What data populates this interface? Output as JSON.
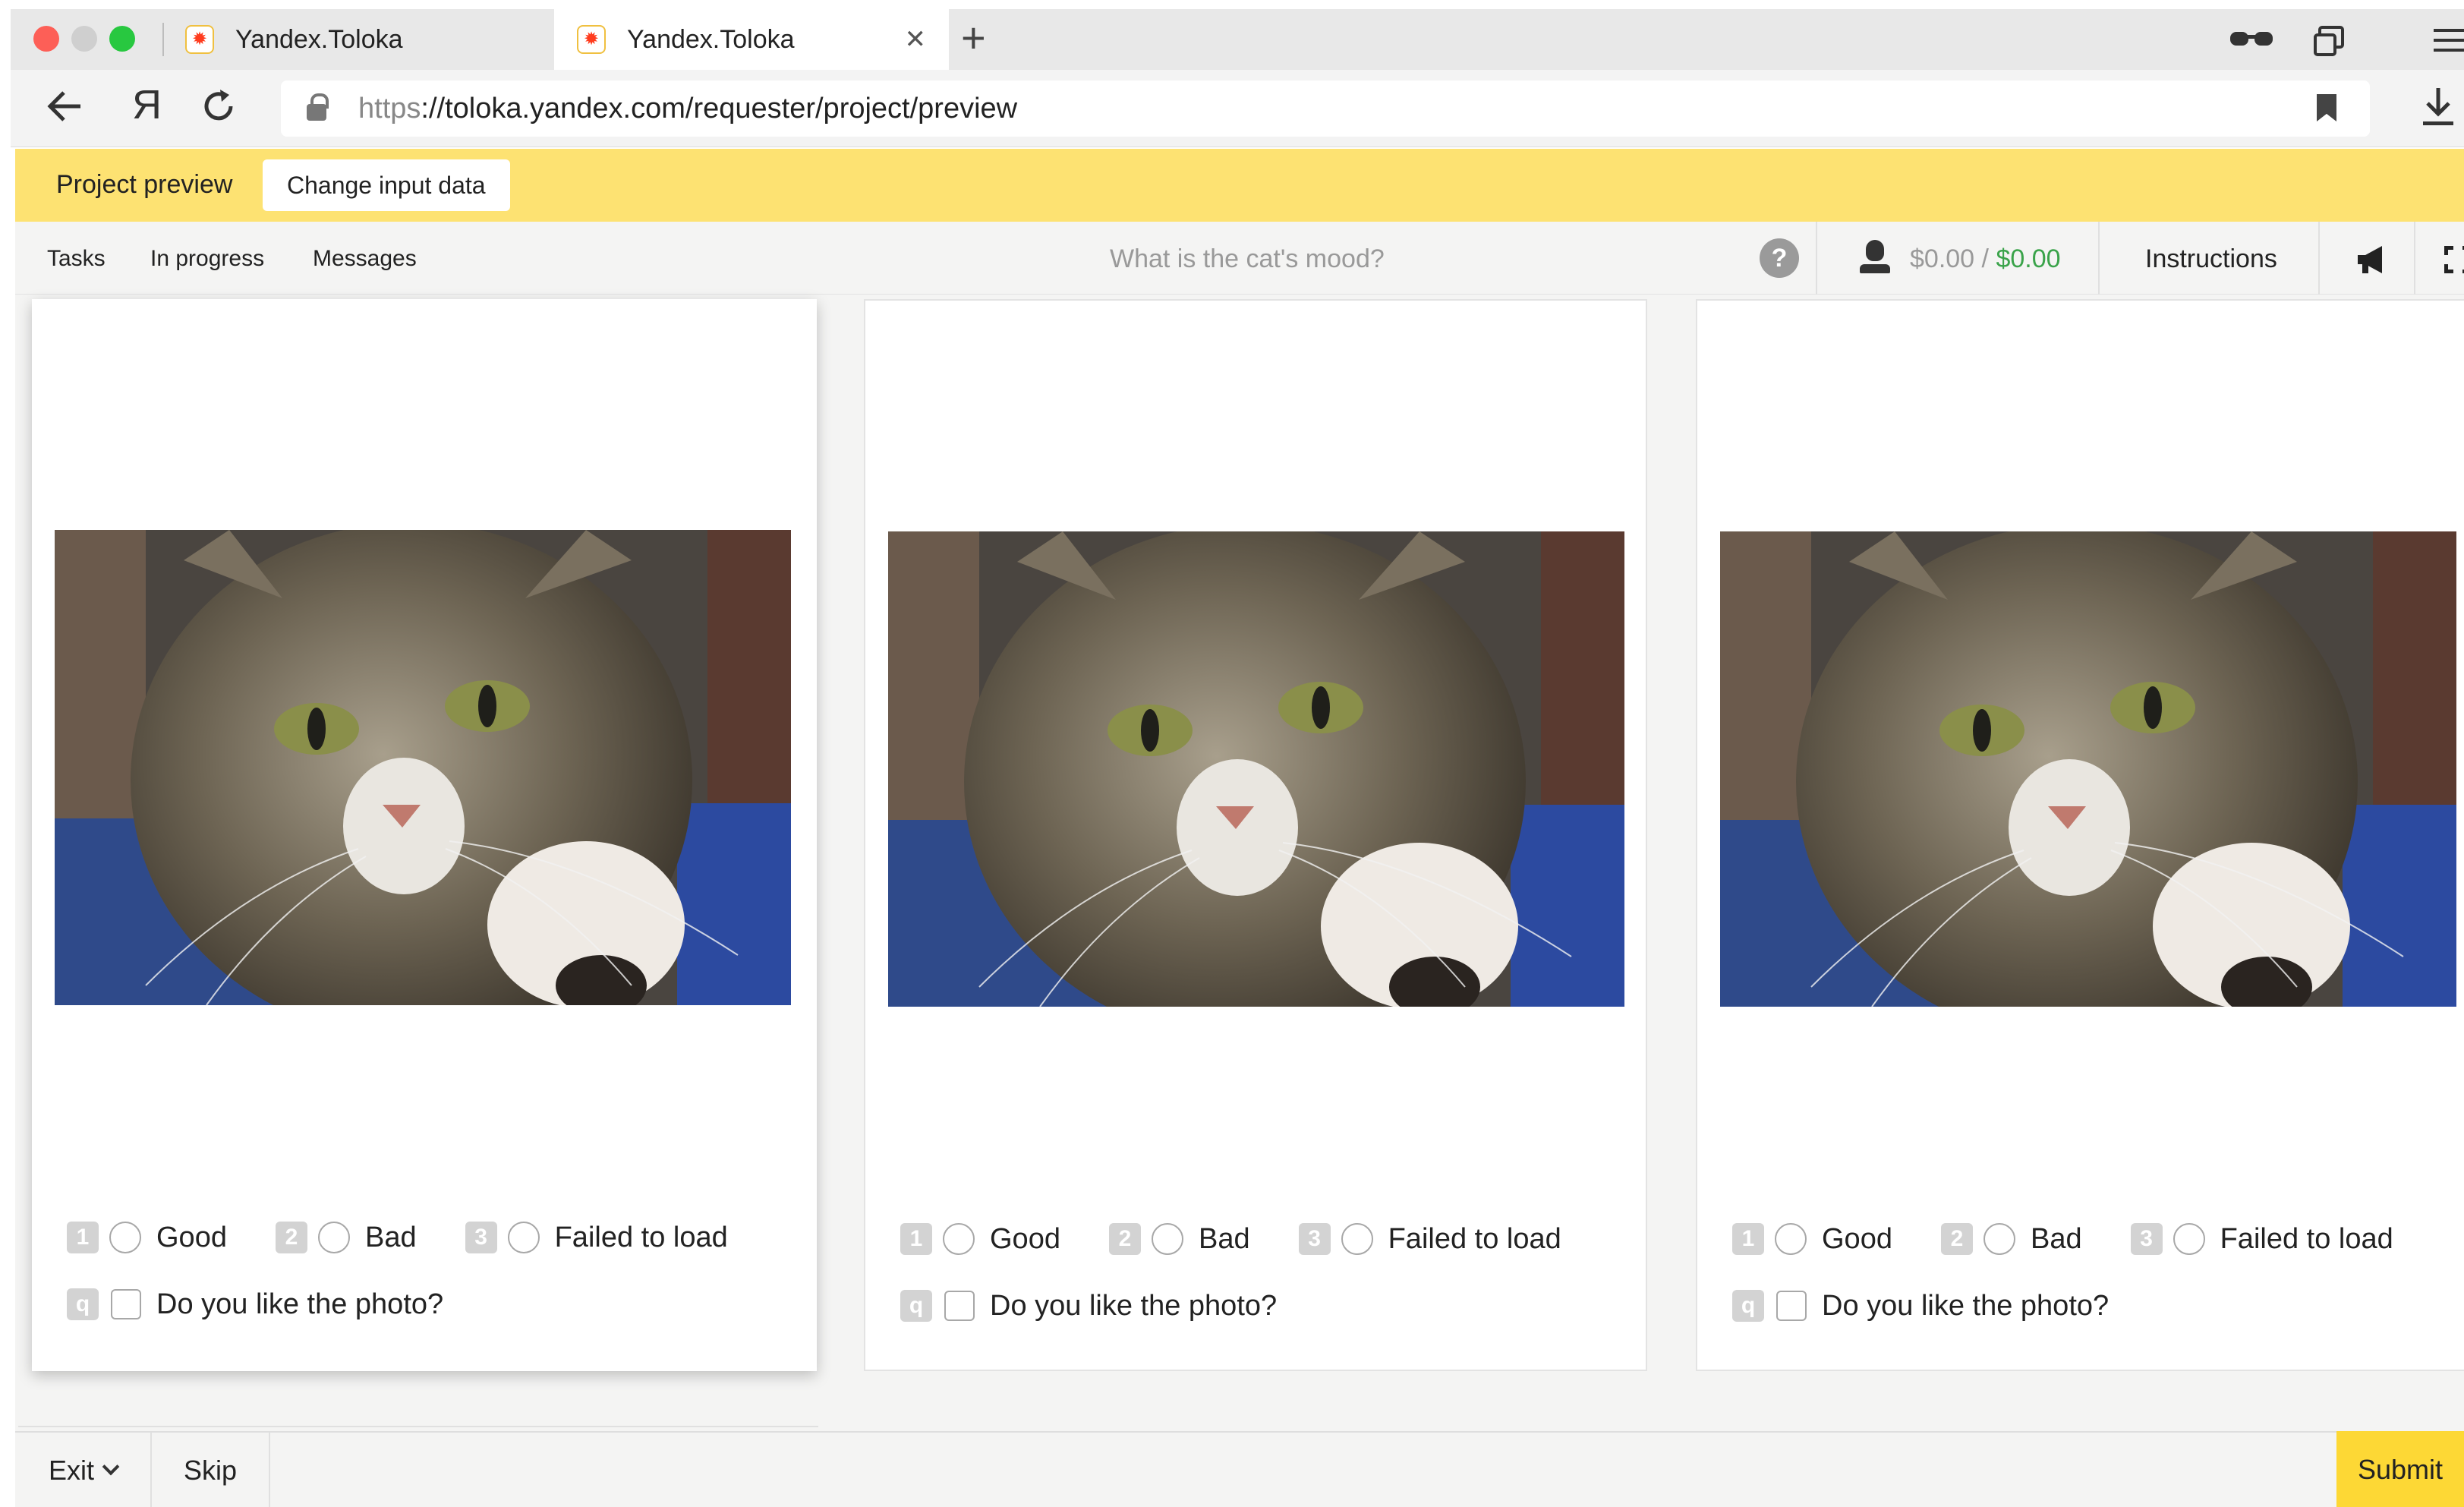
{
  "browser": {
    "tabs": [
      {
        "label": "Yandex.Toloka",
        "active": false
      },
      {
        "label": "Yandex.Toloka",
        "active": true
      }
    ],
    "tab_close_icon": "close-icon",
    "new_tab_label": "+",
    "url_protocol": "https",
    "url_rest": "://toloka.yandex.com/requester/project/preview",
    "yandex_logo": "Я"
  },
  "preview_bar": {
    "title": "Project preview",
    "change_input_label": "Change input data"
  },
  "task_header": {
    "tasks": "Tasks",
    "in_progress": "In progress",
    "messages": "Messages",
    "question": "What is the cat's mood?",
    "help": "?",
    "balance_current": "$0.00",
    "balance_sep": " / ",
    "balance_total": "$0.00",
    "instructions": "Instructions"
  },
  "task_cards": [
    {
      "options": [
        {
          "key": "1",
          "label": "Good"
        },
        {
          "key": "2",
          "label": "Bad"
        },
        {
          "key": "3",
          "label": "Failed to load"
        }
      ],
      "check": {
        "key": "q",
        "label": "Do you like the photo?"
      }
    },
    {
      "options": [
        {
          "key": "1",
          "label": "Good"
        },
        {
          "key": "2",
          "label": "Bad"
        },
        {
          "key": "3",
          "label": "Failed to load"
        }
      ],
      "check": {
        "key": "q",
        "label": "Do you like the photo?"
      }
    },
    {
      "options": [
        {
          "key": "1",
          "label": "Good"
        },
        {
          "key": "2",
          "label": "Bad"
        },
        {
          "key": "3",
          "label": "Failed to load"
        }
      ],
      "check": {
        "key": "q",
        "label": "Do you like the photo?"
      }
    }
  ],
  "bottom_bar": {
    "exit": "Exit",
    "skip": "Skip",
    "submit": "Submit"
  },
  "colors": {
    "preview_bar": "#fde272",
    "submit": "#fdd835",
    "balance_green": "#3aa34a"
  }
}
